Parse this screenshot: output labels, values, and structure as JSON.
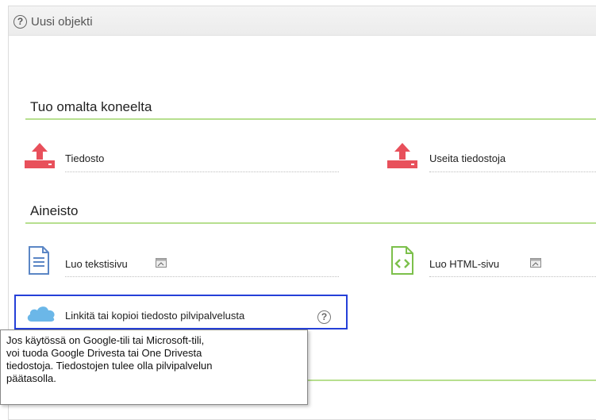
{
  "header": {
    "title": "Uusi objekti",
    "help_glyph": "?"
  },
  "sections": [
    {
      "title": "Tuo omalta koneelta"
    },
    {
      "title": "Aineisto"
    }
  ],
  "upload": {
    "file": "Tiedosto",
    "multiple": "Useita tiedostoja"
  },
  "material": {
    "text_page": "Luo tekstisivu",
    "html_page": "Luo HTML-sivu",
    "cloud": "Linkitä tai kopioi tiedosto pilvipalvelusta",
    "cloud_help_glyph": "?"
  },
  "tooltip": {
    "text": "Jos käytössä on Google-tili tai Microsoft-tili,\nvoi tuoda Google Drivesta tai One Drivesta\ntiedostoja. Tiedostojen tulee olla pilvipalvelun\npäätasolla."
  },
  "colors": {
    "upload_icon": "#e8505b",
    "section_line": "#b7df8f",
    "doc_icon": "#5b86c5",
    "html_icon": "#7cc04b",
    "cloud_icon": "#6bb7e8",
    "highlight": "#2540d8"
  }
}
